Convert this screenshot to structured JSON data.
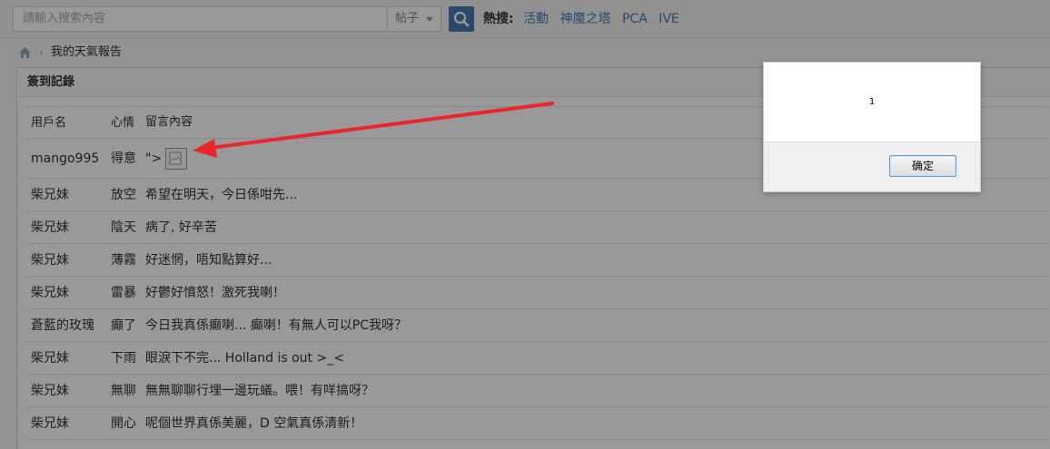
{
  "topbar": {
    "search_placeholder": "請輸入搜索內容",
    "search_type": "帖子",
    "hot_label": "熱搜:",
    "hot_links": [
      "活動",
      "神魔之塔",
      "PCA",
      "IVE"
    ]
  },
  "breadcrumb": {
    "home_icon": "home-icon",
    "page": "我的天氣報告"
  },
  "panel": {
    "title": "簽到記錄",
    "columns": [
      "用戶名",
      "心情",
      "留言內容"
    ],
    "rows": [
      {
        "user": "mango995",
        "mood": "得意",
        "message": "\">"
      },
      {
        "user": "柴兄妹",
        "mood": "放空",
        "message": "希望在明天，今日係咁先..."
      },
      {
        "user": "柴兄妹",
        "mood": "陰天",
        "message": "病了, 好辛苦"
      },
      {
        "user": "柴兄妹",
        "mood": "薄霧",
        "message": "好迷惘，唔知點算好..."
      },
      {
        "user": "柴兄妹",
        "mood": "雷暴",
        "message": "好鬱好憤怒！激死我喇！"
      },
      {
        "user": "蒼藍的玫瑰",
        "mood": "癲了",
        "message": "今日我真係癲喇... 癲喇！有無人可以PC我呀？"
      },
      {
        "user": "柴兄妹",
        "mood": "下雨",
        "message": "眼淚下不完... Holland is out >_<"
      },
      {
        "user": "柴兄妹",
        "mood": "無聊",
        "message": "無無聊聊行埋一邊玩蟻。喂！有咩搞呀？"
      },
      {
        "user": "柴兄妹",
        "mood": "開心",
        "message": "呢個世界真係美麗，D 空氣真係清新！"
      }
    ]
  },
  "dialog": {
    "message": "1",
    "ok_label": "确定"
  },
  "colors": {
    "accent": "#4a7ab3",
    "arrow": "#e8262b",
    "overlay": "rgba(0,0,0,0.4)"
  }
}
